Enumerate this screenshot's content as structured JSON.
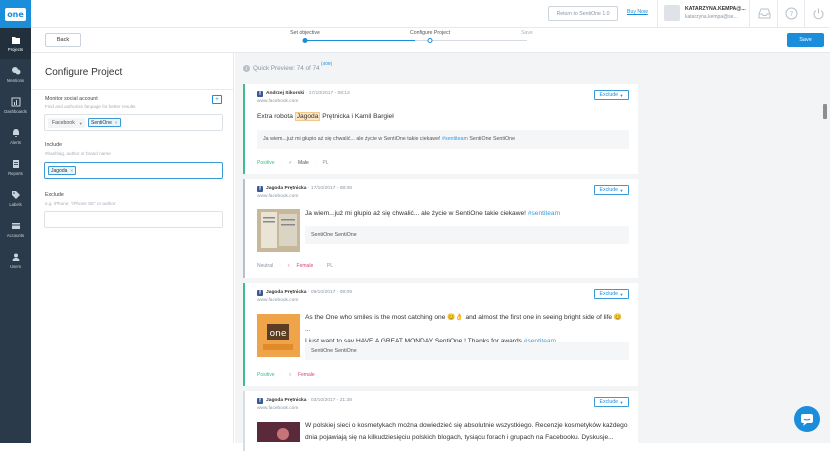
{
  "app": {
    "logo_text": "one"
  },
  "nav": [
    {
      "label": "Projects",
      "icon": "folder-icon",
      "active": true
    },
    {
      "label": "Mentions",
      "icon": "mentions-icon"
    },
    {
      "label": "Dashboards",
      "icon": "dashboard-icon"
    },
    {
      "label": "Alerts",
      "icon": "bell-icon"
    },
    {
      "label": "Reports",
      "icon": "reports-icon"
    },
    {
      "label": "Labels",
      "icon": "tag-icon"
    },
    {
      "label": "Accounts",
      "icon": "accounts-icon"
    },
    {
      "label": "Users",
      "icon": "users-icon"
    }
  ],
  "topbar": {
    "return_label": "Return to SentiOne 1.0",
    "buy_now": "Buy Now",
    "user_name": "KATARZYNA.KEMPA@...",
    "user_email": "katarzyna.kempa@se..."
  },
  "stepbar": {
    "back": "Back",
    "save": "Save",
    "steps": [
      "Set objective",
      "Configure Project",
      "Save"
    ]
  },
  "config": {
    "title": "Configure Project",
    "monitor": {
      "label": "Monitor social account",
      "hint": "Find and authorize fanpage for better results",
      "add": "+",
      "platform": "Facebook",
      "tag": "SentiOne"
    },
    "include": {
      "label": "Include",
      "hint": "#hashtag, author or brand name",
      "tag": "Jagoda"
    },
    "exclude": {
      "label": "Exclude",
      "hint": "e.g. iPhone, \"iPhone SE\" or author"
    }
  },
  "preview": {
    "label": "Quick Preview: 74 of 74",
    "count": "(409)",
    "info_icon": "i",
    "cards": [
      {
        "author": "Andrzej Sikorski",
        "date": "17/10/2017 - 08:13",
        "domain": "www.facebook.com",
        "exclude": "Exclude",
        "text_pre": "Extra robota ",
        "highlight": "Jagoda",
        "text_post": " Prętnicka i Kamil Bargieł",
        "quote_text": "Ja wiem...już mi głupio aż się chwalić... ale życie w SentiOne takie ciekawe! ",
        "quote_link": "#sentiteam",
        "quote_tail": " SentiOne SentiOne",
        "sentiment": "Positive",
        "gender": "Male",
        "lang": "PL"
      },
      {
        "author": "Jagoda Prętnicka",
        "date": "17/10/2017 - 08:08",
        "domain": "www.facebook.com",
        "exclude": "Exclude",
        "text": "Ja wiem...już mi głupio aż się chwalić... ale życie w SentiOne takie ciekawe! ",
        "text_link": "#sentiteam",
        "sub": "SentiOne SentiOne",
        "sentiment": "Neutral",
        "gender": "Female",
        "lang": "PL"
      },
      {
        "author": "Jagoda Prętnicka",
        "date": "09/10/2017 - 09:09",
        "domain": "www.facebook.com",
        "exclude": "Exclude",
        "text_line1": "As the One who smiles is the most catching one 😊👌 and almost the first one in seeing bright side of life 😊 ...",
        "text_line2": "I just want to say HAVE A GREAT MONDAY SentiOne ! Thanks for awards ",
        "text_link": "#sentiteam",
        "sub": "SentiOne SentiOne",
        "sentiment": "Positive",
        "gender": "Female"
      },
      {
        "author": "Jagoda Prętnicka",
        "date": "03/10/2017 - 21:38",
        "domain": "www.facebook.com",
        "exclude": "Exclude",
        "text_line1": "W polskiej sieci o kosmetykach można dowiedzieć się absolutnie wszystkiego. Recenzje kosmetyków każdego",
        "text_line2": "dnia pojawiają się na kilkudziesięciu polskich blogach, tysiącu forach i grupach na Facebooku. Dyskusje..."
      }
    ]
  }
}
